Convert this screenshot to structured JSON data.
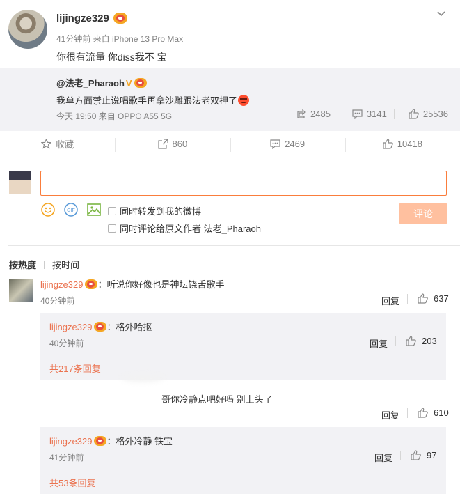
{
  "post": {
    "username": "lijingze329",
    "meta": "41分钟前 来自 iPhone 13 Pro Max",
    "text": "你很有流量 你diss我不 宝"
  },
  "repost": {
    "user": "@法老_Pharaoh",
    "verified": "V",
    "text": "我单方面禁止说唱歌手再拿沙雕跟法老双押了",
    "meta": "今天 19:50 来自 OPPO A55 5G",
    "reposts": "2485",
    "comments": "3141",
    "likes": "25536"
  },
  "actions": {
    "favorite": "收藏",
    "repost": "860",
    "comment": "2469",
    "like": "10418"
  },
  "composer": {
    "input_value": "",
    "opt1": "同时转发到我的微博",
    "opt2": "同时评论给原文作者 法老_Pharaoh",
    "submit": "评论",
    "gif_label": "GIF"
  },
  "sort": {
    "hot": "按热度",
    "time": "按时间"
  },
  "comments": [
    {
      "name": "lijingze329",
      "text": "：听说你好像也是神坛饶舌歌手",
      "time": "40分钟前",
      "reply": "回复",
      "likes": "637",
      "sub": {
        "name": "lijingze329",
        "text": "：格外哈抠",
        "time": "40分钟前",
        "reply": "回复",
        "likes": "203"
      },
      "more": "共217条回复"
    },
    {
      "name": "",
      "text": "哥你冷静点吧好吗 别上头了",
      "reply": "回复",
      "likes": "610",
      "sub": {
        "name": "lijingze329",
        "text": "：格外冷静 铁宝",
        "time": "41分钟前",
        "reply": "回复",
        "likes": "97"
      },
      "more": "共53条回复"
    }
  ],
  "colors": {
    "accent": "#eb7350",
    "input_border": "#fa7d3c",
    "submit_bg": "#ffc09f",
    "repost_bg": "#f2f2f5"
  }
}
